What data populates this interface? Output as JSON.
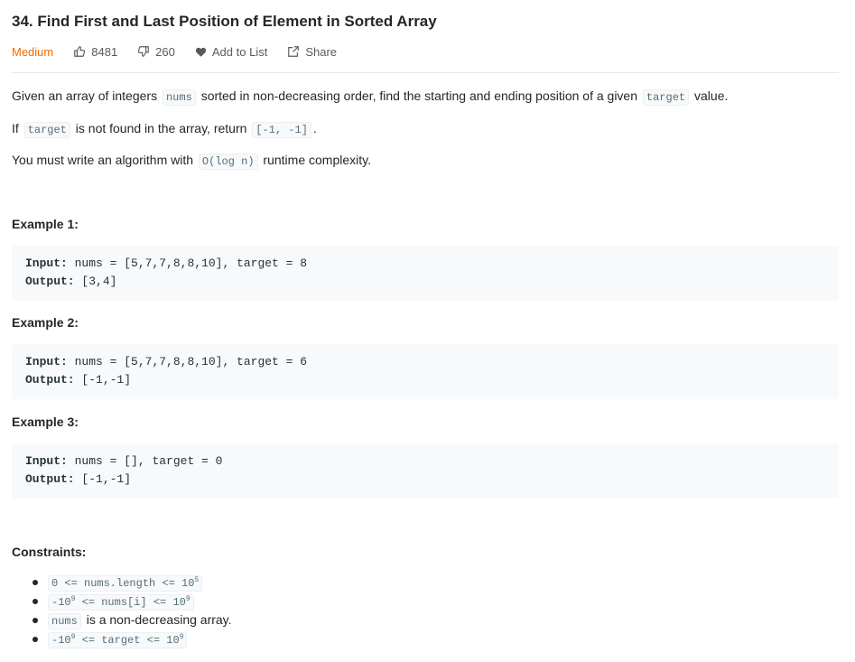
{
  "problem": {
    "title": "34. Find First and Last Position of Element in Sorted Array",
    "difficulty": "Medium",
    "likes": "8481",
    "dislikes": "260",
    "add_to_list": "Add to List",
    "share": "Share"
  },
  "description": {
    "p1_a": "Given an array of integers",
    "p1_code1": "nums",
    "p1_b": "sorted in non-decreasing order, find the starting and ending position of a given",
    "p1_code2": "target",
    "p1_c": "value.",
    "p2_a": "If",
    "p2_code1": "target",
    "p2_b": "is not found in the array, return",
    "p2_code2": "[-1, -1]",
    "p2_c": ".",
    "p3_a": "You must write an algorithm with",
    "p3_code": "O(log n)",
    "p3_b": "runtime complexity."
  },
  "examples": [
    {
      "heading": "Example 1:",
      "input_label": "Input:",
      "input": "nums = [5,7,7,8,8,10], target = 8",
      "output_label": "Output:",
      "output": "[3,4]"
    },
    {
      "heading": "Example 2:",
      "input_label": "Input:",
      "input": "nums = [5,7,7,8,8,10], target = 6",
      "output_label": "Output:",
      "output": "[-1,-1]"
    },
    {
      "heading": "Example 3:",
      "input_label": "Input:",
      "input": "nums = [], target = 0",
      "output_label": "Output:",
      "output": "[-1,-1]"
    }
  ],
  "constraints": {
    "heading": "Constraints:",
    "c1_a": "0 <= nums.length <= 10",
    "c1_sup": "5",
    "c2_a": "-10",
    "c2_sup1": "9",
    "c2_b": " <= nums[i] <= 10",
    "c2_sup2": "9",
    "c3_code": "nums",
    "c3_text": "is a non-decreasing array.",
    "c4_a": "-10",
    "c4_sup1": "9",
    "c4_b": " <= target <= 10",
    "c4_sup2": "9"
  },
  "colors": {
    "difficulty_medium": "#ef6c00",
    "code_bg": "#f7f9fa",
    "code_text": "#546e7a"
  },
  "icons": [
    "thumbs-up-icon",
    "thumbs-down-icon",
    "heart-icon",
    "share-icon"
  ]
}
